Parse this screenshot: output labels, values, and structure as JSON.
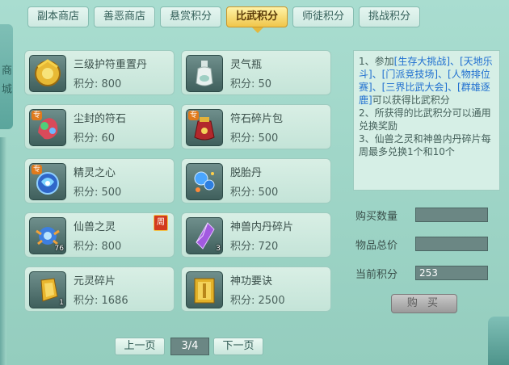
{
  "side": {
    "label": "商城"
  },
  "tabs": [
    {
      "label": "副本商店",
      "active": false
    },
    {
      "label": "善恶商店",
      "active": false
    },
    {
      "label": "悬赏积分",
      "active": false
    },
    {
      "label": "比武积分",
      "active": true
    },
    {
      "label": "师徒积分",
      "active": false
    },
    {
      "label": "挑战积分",
      "active": false
    }
  ],
  "items": [
    {
      "name": "三级护符重置丹",
      "price": "积分: 800",
      "icon": "golden-amulet-icon"
    },
    {
      "name": "灵气瓶",
      "price": "积分: 50",
      "icon": "spirit-bottle-icon"
    },
    {
      "name": "尘封的符石",
      "price": "积分: 60",
      "icon": "sealed-runestone-icon",
      "special": "专"
    },
    {
      "name": "符石碎片包",
      "price": "积分: 500",
      "icon": "runestone-bag-icon",
      "special": "专"
    },
    {
      "name": "精灵之心",
      "price": "积分: 500",
      "icon": "elf-heart-icon",
      "special": "专"
    },
    {
      "name": "脱胎丹",
      "price": "积分: 500",
      "icon": "rebirth-pill-icon"
    },
    {
      "name": "仙兽之灵",
      "price": "积分: 800",
      "icon": "beast-spirit-icon",
      "count": "76"
    },
    {
      "name": "神兽内丹碎片",
      "price": "积分: 720",
      "icon": "beast-core-fragment-icon",
      "count": "3"
    },
    {
      "name": "元灵碎片",
      "price": "积分: 1686",
      "icon": "yuanling-fragment-icon",
      "count": "1"
    },
    {
      "name": "神功要诀",
      "price": "积分: 2500",
      "icon": "skill-book-icon"
    }
  ],
  "week_tag": "周",
  "info": {
    "p1_prefix": "1、参加",
    "p1_links": "[生存大挑战]、[天地乐斗]、[门派竞技场]、[人物排位赛]、[三界比武大会]、[群雄逐鹿]",
    "p1_suffix": "可以获得比武积分",
    "p2": "2、所获得的比武积分可以通用兑换奖励",
    "p3": "3、仙兽之灵和神兽内丹碎片每周最多兑换1个和10个"
  },
  "form": {
    "qty_label": "购买数量",
    "qty_value": "",
    "total_label": "物品总价",
    "total_value": "",
    "current_label": "当前积分",
    "current_value": "253"
  },
  "buy_label": "购 买",
  "pager": {
    "prev": "上一页",
    "page": "3/4",
    "next": "下一页"
  }
}
